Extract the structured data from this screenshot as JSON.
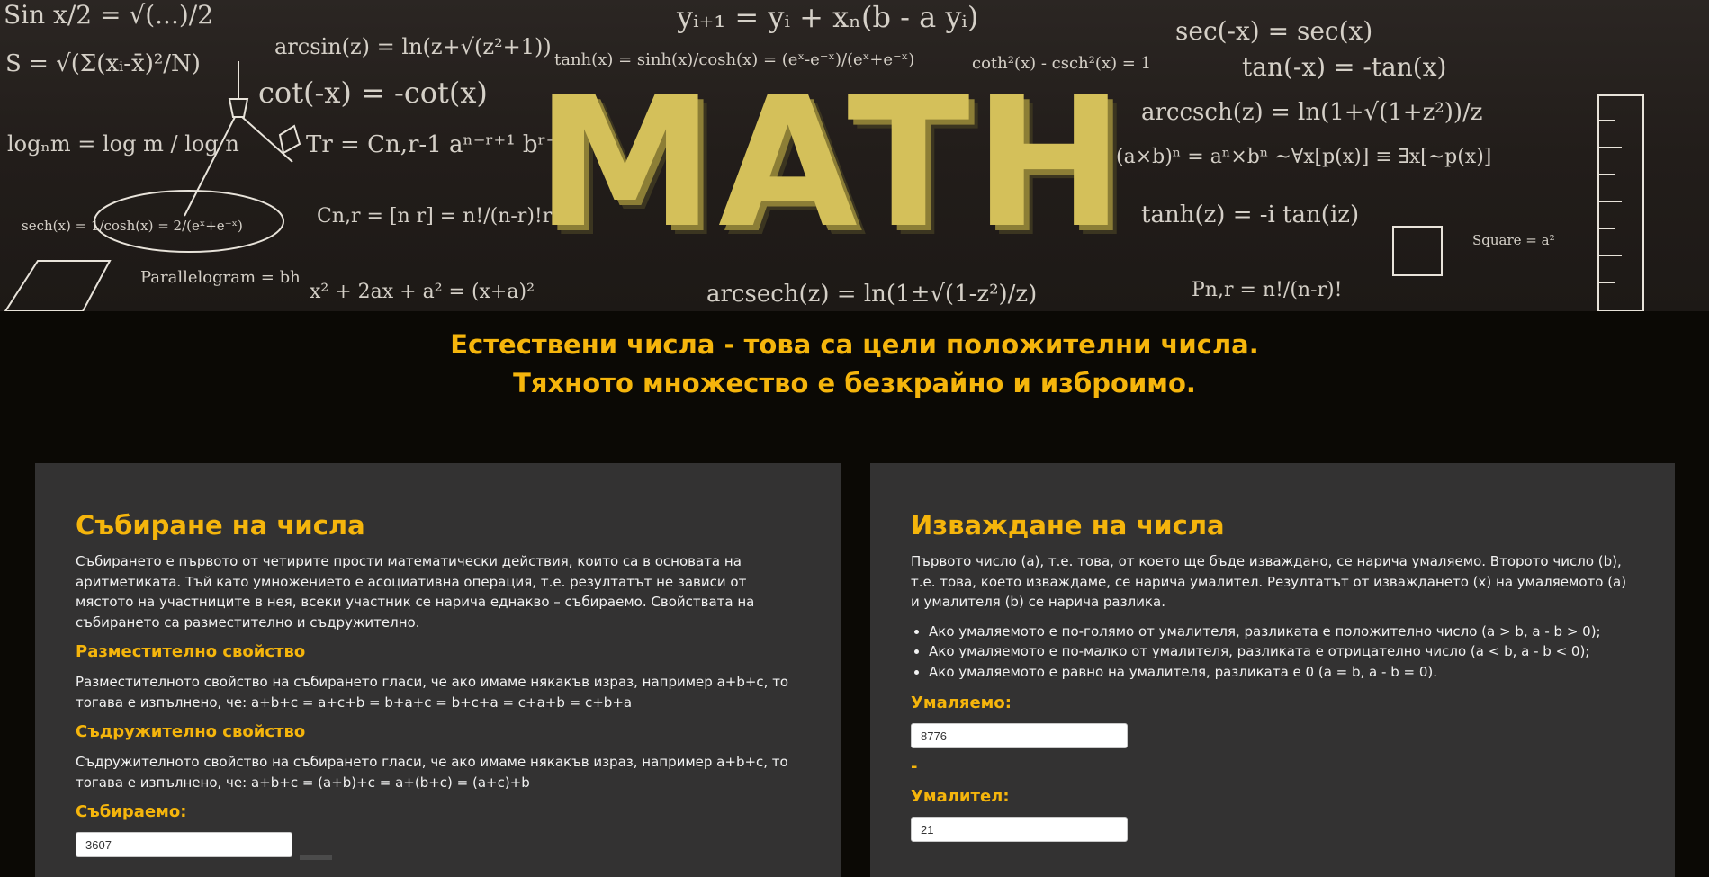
{
  "hero": {
    "title": "MATH",
    "formulas": [
      "Sin x/2 = √(...)/2",
      "S = √(Σ(xᵢ-x̄)²/N)",
      "arcsin(z) = ln(z+√(z²+1))",
      "cot(-x) = -cot(x)",
      "logₙm = log m / log n",
      "Tr = Cn,r-1 aⁿ⁻ʳ⁺¹ bʳ⁻¹",
      "sech(x) = 1/cosh(x) = 2/(eˣ+e⁻ˣ)",
      "Cn,r = [n r] = n!/(n-r)!r!",
      "Parallelogram = bh",
      "x² + 2ax + a² = (x+a)²",
      "yᵢ₊₁ = yᵢ + xₙ(b - a yᵢ)",
      "tanh(x) = sinh(x)/cosh(x) = (eˣ-e⁻ˣ)/(eˣ+e⁻ˣ)",
      "coth²(x) - csch²(x) = 1",
      "arcsech(z) = ln(1±√(1-z²)/z)",
      "sec(-x) = sec(x)",
      "tan(-x) = -tan(x)",
      "arccsch(z) = ln(1+√(1+z²))/z",
      "(a×b)ⁿ = aⁿ×bⁿ ~∀x[p(x)] ≡ ∃x[~p(x)]",
      "tanh(z) = -i tan(iz)",
      "Square = a²",
      "Pn,r = n!/(n-r)!"
    ]
  },
  "intro": {
    "line1": "Естествени числа - това са цели положителни числа.",
    "line2": "Тяхното множество е безкрайно и изброимо."
  },
  "addition": {
    "title": "Събиране на числа",
    "description": "Събирането е първото от четирите прости математически действия, които са в основата на аритметиката. Тъй като умножението е асоциативна операция, т.е. резултатът не зависи от мястото на участниците в нея, всеки участник се нарича еднакво – събираемо. Свойствата на събирането са разместително и съдружително.",
    "commutative_title": "Разместително свойство",
    "commutative_text": "Разместителното свойство на събирането гласи, че ако имаме някакъв израз, например a+b+c, то тогава е изпълнено, че: a+b+c = a+c+b = b+a+c = b+c+a = c+a+b = c+b+a",
    "associative_title": "Съдружително свойство",
    "associative_text": "Съдружителното свойство на събирането гласи, че ако имаме някакъв израз, например a+b+c, то тогава е изпълнено, че: a+b+c = (a+b)+c = a+(b+c) = (a+c)+b",
    "input_label": "Събираемо:",
    "input_value": "3607"
  },
  "subtraction": {
    "title": "Изваждане на числа",
    "description": "Първото число (a), т.е. това, от което ще бъде изваждано, се нарича умаляемо. Второто число (b), т.е. това, което изваждаме, се нарича умалител. Резултатът от изваждането (x) на умаляемото (a) и умалителя (b) се нарича разлика.",
    "rules": [
      "Ако умаляемото е по-голямо от умалителя, разликата е положително число (a > b, a - b > 0);",
      "Ако умаляемото е по-малко от умалителя, разликата е отрицателно число (a < b, a - b < 0);",
      "Ако умаляемото е равно на умалителя, разликата е 0 (a = b, a - b = 0)."
    ],
    "minuend_label": "Умаляемо:",
    "minuend_value": "8776",
    "operator": "-",
    "subtrahend_label": "Умалител:",
    "subtrahend_value": "21"
  }
}
